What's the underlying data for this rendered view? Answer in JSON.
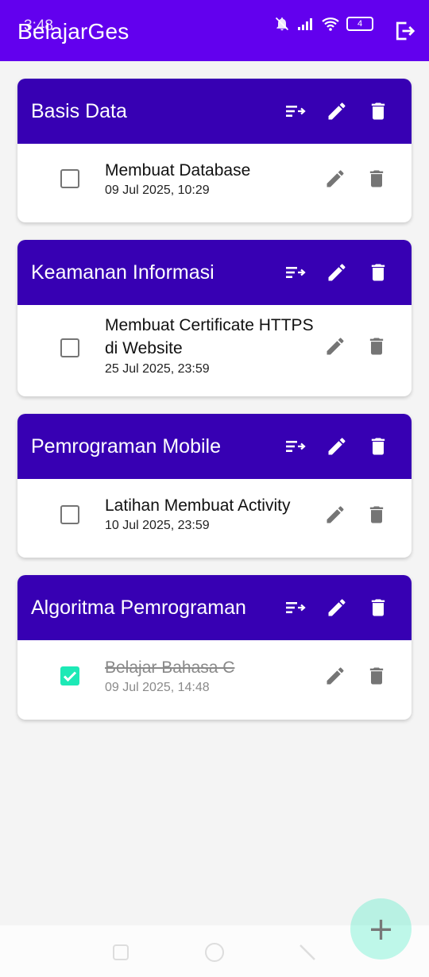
{
  "status_bar": {
    "time": "3:48",
    "battery": "4"
  },
  "app_bar": {
    "title": "BelajarGes"
  },
  "courses": [
    {
      "title": "Basis Data",
      "tasks": [
        {
          "title": "Membuat Database",
          "date": "09 Jul 2025, 10:29",
          "done": false
        }
      ]
    },
    {
      "title": "Keamanan Informasi",
      "tasks": [
        {
          "title": "Membuat Certificate HTTPS di Website",
          "date": "25 Jul 2025, 23:59",
          "done": false
        }
      ]
    },
    {
      "title": "Pemrograman Mobile",
      "tasks": [
        {
          "title": "Latihan Membuat Activity",
          "date": "10 Jul 2025, 23:59",
          "done": false
        }
      ]
    },
    {
      "title": "Algoritma Pemrograman",
      "tasks": [
        {
          "title": "Belajar Bahasa C",
          "date": "09 Jul 2025, 14:48",
          "done": true
        }
      ]
    }
  ],
  "fab": {
    "symbol": "+"
  },
  "colors": {
    "app_bar": "#6200ee",
    "card_header": "#3700b3",
    "accent": "#1de9b6"
  }
}
